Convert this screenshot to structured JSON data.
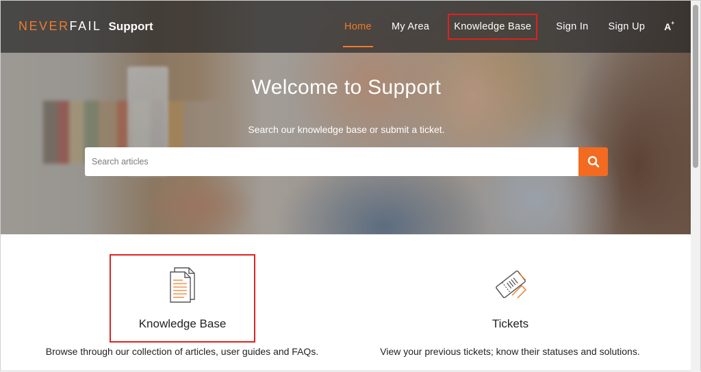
{
  "brand": {
    "logo_part1": "NEVER",
    "logo_part2": "FAIL",
    "title": "Support"
  },
  "nav": {
    "items": [
      {
        "label": "Home"
      },
      {
        "label": "My Area"
      },
      {
        "label": "Knowledge Base"
      },
      {
        "label": "Sign In"
      },
      {
        "label": "Sign Up"
      }
    ],
    "font_size_label": "A",
    "font_size_sup": "+"
  },
  "hero": {
    "title": "Welcome to Support",
    "subtitle": "Search our knowledge base or submit a ticket.",
    "search_placeholder": "Search articles",
    "search_value": ""
  },
  "cards": [
    {
      "title": "Knowledge Base",
      "description": "Browse through our collection of articles, user guides and FAQs.",
      "icon": "documents-icon"
    },
    {
      "title": "Tickets",
      "description": "View your previous tickets; know their statuses and solutions.",
      "icon": "ticket-icon"
    }
  ],
  "colors": {
    "accent": "#f26b21",
    "highlight_box": "#e02020",
    "topbar": "#282828"
  }
}
